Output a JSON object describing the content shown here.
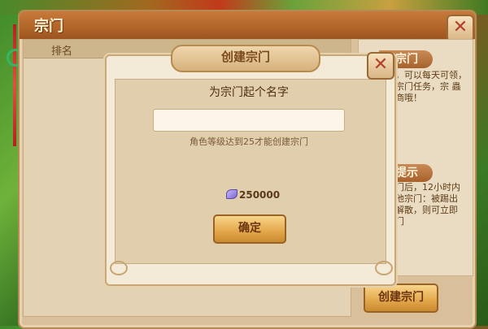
{
  "main_window": {
    "title": "宗门",
    "close_label": "✕"
  },
  "rank_table": {
    "columns": [
      "排名"
    ]
  },
  "side_panel": {
    "join_title": "入宗门",
    "join_text": "，可以每天可领，宗门任务，宗 蟲商哦！",
    "tip_title": "馨提示",
    "tip_text": "门后，12小时内 他宗门：被踢出 解散，则可立即 门"
  },
  "create_button_label": "创建宗门",
  "dialog": {
    "title": "创建宗门",
    "close_label": "✕",
    "prompt": "为宗门起个名字",
    "input_value": "",
    "hint": "角色等级达到25才能创建宗门",
    "cost": "250000",
    "confirm_label": "确定"
  }
}
